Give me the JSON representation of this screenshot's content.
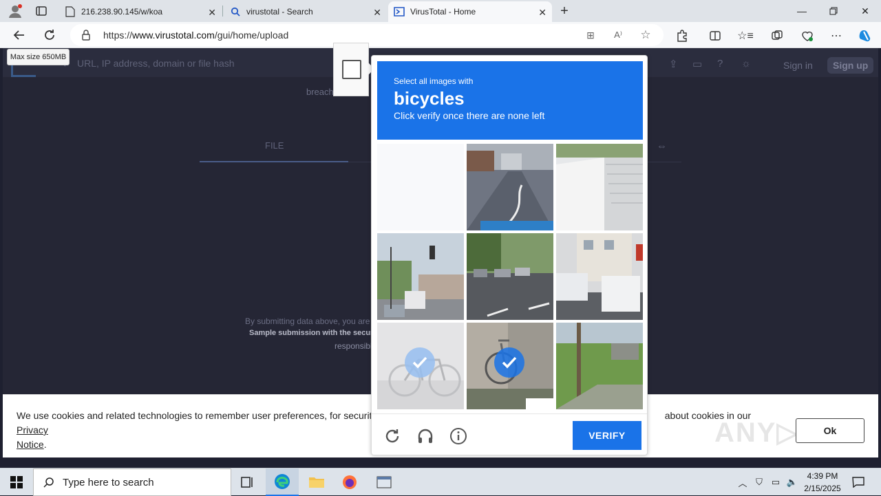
{
  "browser": {
    "tabs": [
      {
        "label": "216.238.90.145/w/koa",
        "icon": "page-icon"
      },
      {
        "label": "virustotal - Search",
        "icon": "search-icon"
      },
      {
        "label": "VirusTotal - Home",
        "icon": "virustotal-icon",
        "active": true
      }
    ],
    "url_prefix": "https://",
    "url_host": "www.virustotal.com",
    "url_path": "/gui/home/upload"
  },
  "tooltip": {
    "text": "Max size 650MB"
  },
  "virustotal": {
    "search_placeholder": "URL, IP address, domain or file hash",
    "signin": "Sign in",
    "signup": "Sign up",
    "breach_fragment": "breach",
    "file_tab": "FILE",
    "submit_line1": "By submitting data above, you are a",
    "submit_line2": "Sample submission with the secur",
    "submit_line3": "responsibl"
  },
  "captcha": {
    "line1": "Select all images with",
    "keyword": "bicycles",
    "line3": "Click verify once there are none left",
    "verify_label": "VERIFY",
    "selected_tiles": [
      6,
      7
    ]
  },
  "cookie": {
    "text_start": "We use cookies and related technologies to remember user preferences, for security, to",
    "text_mid": "about cookies in our",
    "link1": "Privacy",
    "link2": "Notice",
    "period": ".",
    "ok_label": "Ok"
  },
  "watermark": {
    "text": "ANY▷RUN"
  },
  "taskbar": {
    "search_placeholder": "Type here to search",
    "time": "4:39 PM",
    "date": "2/15/2025"
  },
  "colors": {
    "accent": "#1a73e8",
    "page_bg": "#252635"
  }
}
